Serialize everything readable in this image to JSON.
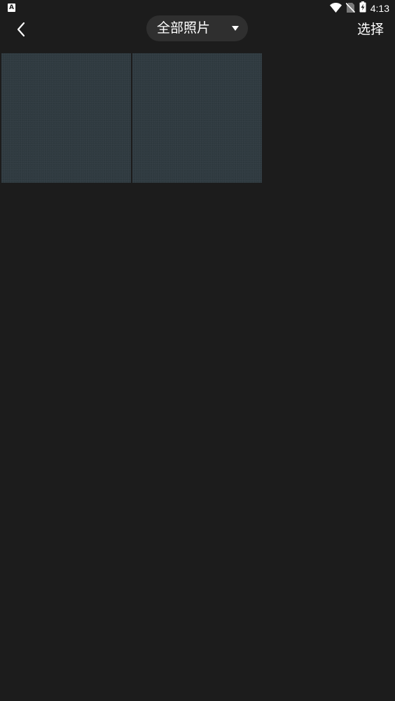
{
  "status_bar": {
    "left_icon": "A",
    "left_icon_name": "keyboard-a-notification-icon",
    "icons": [
      "wifi-icon",
      "no-sim-icon",
      "battery-charging-icon"
    ],
    "time": "4:13"
  },
  "top_bar": {
    "back_icon": "chevron-left-icon",
    "album_label": "全部照片",
    "dropdown_icon": "triangle-down-icon",
    "select_label": "选择"
  },
  "photos": [
    {
      "name": "photo-1"
    },
    {
      "name": "photo-2"
    }
  ],
  "colors": {
    "background": "#1c1c1c",
    "selector_bg": "#2f2f2f",
    "thumbnail": "#2f3a40",
    "text": "#ffffff"
  }
}
